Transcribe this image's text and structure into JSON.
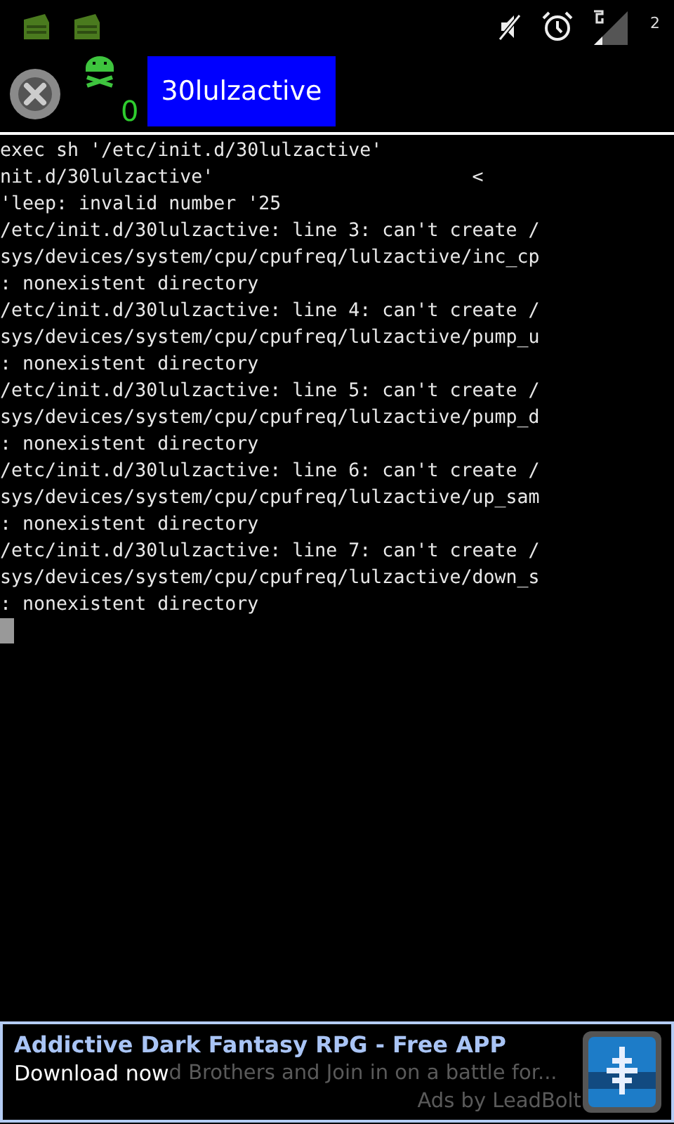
{
  "status_bar": {
    "battery_text": "2"
  },
  "toolbar": {
    "window_count": "0",
    "tabs": [
      {
        "label": "30lulzactive",
        "selected": true
      }
    ]
  },
  "terminal": {
    "lines": [
      "exec sh '/etc/init.d/30lulzactive'",
      "nit.d/30lulzactive'                       <",
      "'leep: invalid number '25",
      "/etc/init.d/30lulzactive: line 3: can't create /",
      "sys/devices/system/cpu/cpufreq/lulzactive/inc_cp",
      ": nonexistent directory",
      "/etc/init.d/30lulzactive: line 4: can't create /",
      "sys/devices/system/cpu/cpufreq/lulzactive/pump_u",
      ": nonexistent directory",
      "/etc/init.d/30lulzactive: line 5: can't create /",
      "sys/devices/system/cpu/cpufreq/lulzactive/pump_d",
      ": nonexistent directory",
      "/etc/init.d/30lulzactive: line 6: can't create /",
      "sys/devices/system/cpu/cpufreq/lulzactive/up_sam",
      ": nonexistent directory",
      "/etc/init.d/30lulzactive: line 7: can't create /",
      "sys/devices/system/cpu/cpufreq/lulzactive/down_s",
      ": nonexistent directory"
    ]
  },
  "ad": {
    "title": "Addictive Dark Fantasy RPG - Free APP",
    "subtitle": "Download now",
    "background_text": "d Brothers and Join in on a battle for...",
    "credit": "Ads by LeadBolt"
  }
}
